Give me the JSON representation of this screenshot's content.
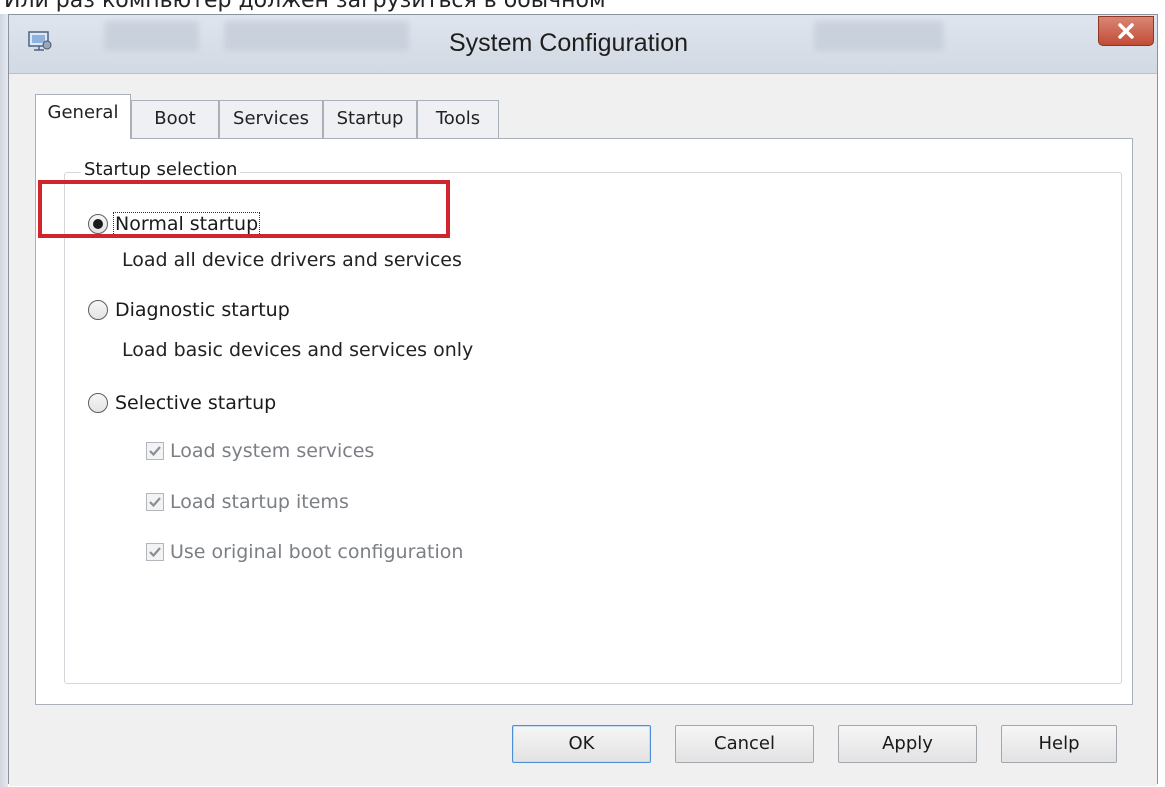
{
  "background_caption": "Или раз компьютер должен загрузиться в обычном",
  "window": {
    "title": "System Configuration",
    "close_icon": "close-icon",
    "app_icon": "msconfig-app-icon"
  },
  "tabs": [
    {
      "label": "General",
      "active": true
    },
    {
      "label": "Boot",
      "active": false
    },
    {
      "label": "Services",
      "active": false
    },
    {
      "label": "Startup",
      "active": false
    },
    {
      "label": "Tools",
      "active": false
    }
  ],
  "startup_selection": {
    "group_label": "Startup selection",
    "options": [
      {
        "label": "Normal startup",
        "description": "Load all device drivers and services",
        "selected": true
      },
      {
        "label": "Diagnostic startup",
        "description": "Load basic devices and services only",
        "selected": false
      },
      {
        "label": "Selective startup",
        "selected": false
      }
    ],
    "selective_items": [
      {
        "label": "Load system services",
        "checked": true,
        "enabled": false
      },
      {
        "label": "Load startup items",
        "checked": true,
        "enabled": false
      },
      {
        "label": "Use original boot configuration",
        "checked": true,
        "enabled": false
      }
    ]
  },
  "buttons": {
    "ok": "OK",
    "cancel": "Cancel",
    "apply": "Apply",
    "help": "Help"
  },
  "colors": {
    "highlight": "#d0242f",
    "close_button": "#c14c36",
    "default_button_border": "#4c8fd6"
  }
}
